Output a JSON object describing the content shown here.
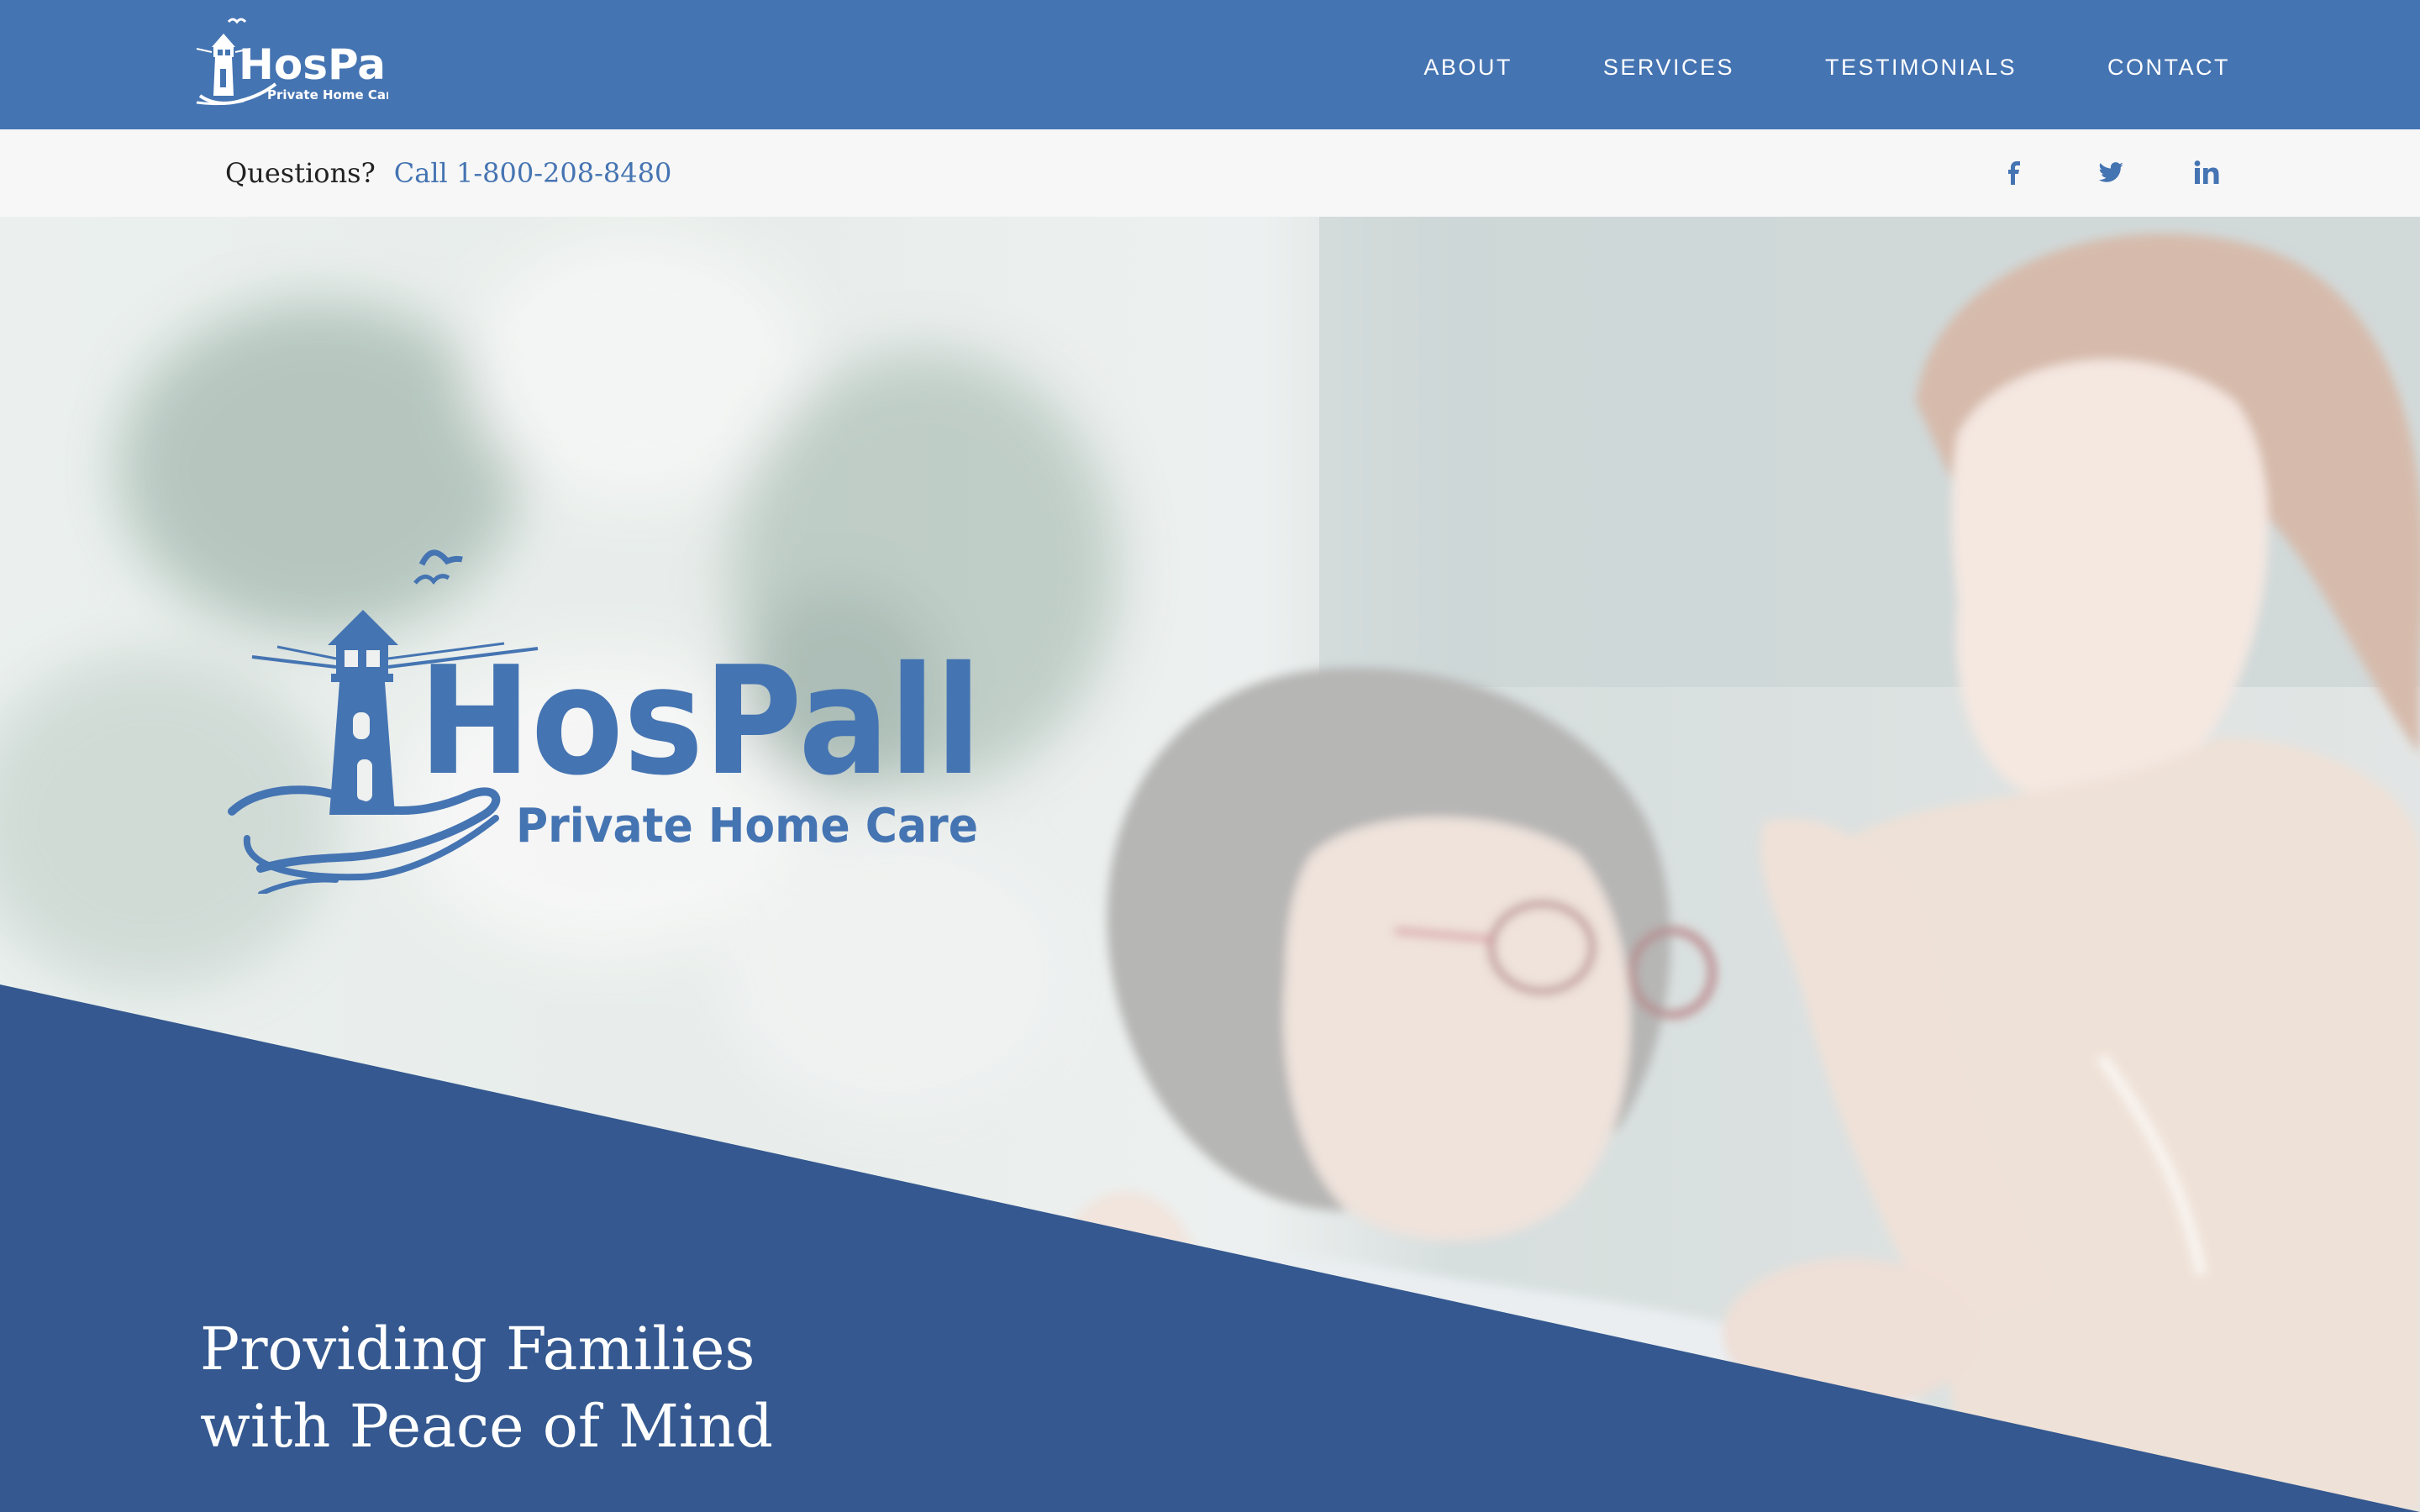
{
  "brand": {
    "name": "HosPall",
    "tagline": "Private Home Care",
    "color": "#4574b2"
  },
  "nav": {
    "items": [
      {
        "label": "ABOUT"
      },
      {
        "label": "SERVICES"
      },
      {
        "label": "TESTIMONIALS"
      },
      {
        "label": "CONTACT"
      }
    ]
  },
  "info": {
    "questions_label": "Questions?",
    "call_label": "Call 1-800-208-8480"
  },
  "social": [
    {
      "icon": "facebook-icon"
    },
    {
      "icon": "twitter-icon"
    },
    {
      "icon": "linkedin-icon"
    }
  ],
  "hero": {
    "heading_line1": "Providing Families",
    "heading_line2": "with Peace of Mind",
    "band_color": "#34588f"
  }
}
